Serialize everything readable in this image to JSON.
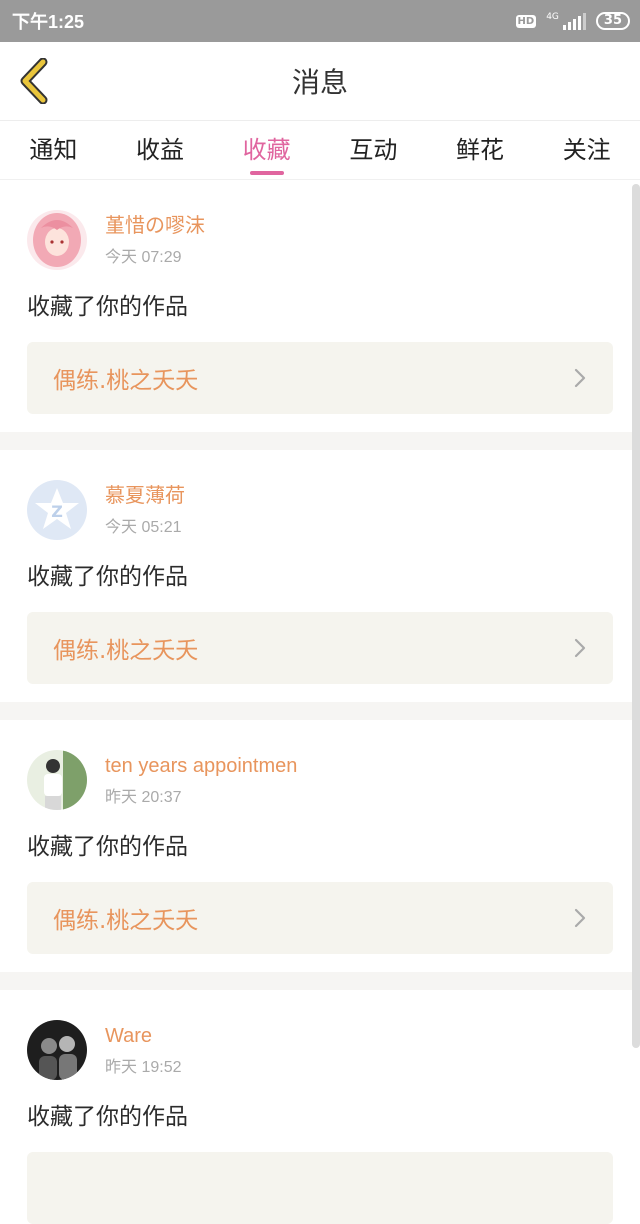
{
  "status_bar": {
    "time": "下午1:25",
    "hd": "HD",
    "network": "4G",
    "battery": "35"
  },
  "header": {
    "title": "消息"
  },
  "tabs": [
    {
      "label": "通知"
    },
    {
      "label": "收益"
    },
    {
      "label": "收藏",
      "active": true
    },
    {
      "label": "互动"
    },
    {
      "label": "鲜花"
    },
    {
      "label": "关注"
    }
  ],
  "messages": [
    {
      "user": "堇惜の嘐沫",
      "time": "今天 07:29",
      "action": "收藏了你的作品",
      "work": "偶练.桃之夭夭"
    },
    {
      "user": "慕夏薄荷",
      "time": "今天 05:21",
      "action": "收藏了你的作品",
      "work": "偶练.桃之夭夭"
    },
    {
      "user": "ten years appointmen",
      "time": "昨天 20:37",
      "action": "收藏了你的作品",
      "work": "偶练.桃之夭夭"
    },
    {
      "user": "Ware",
      "time": "昨天 19:52",
      "action": "收藏了你的作品",
      "work": ""
    }
  ],
  "colors": {
    "accent": "#e0659f",
    "name_orange": "#e8955d",
    "work_box_bg": "#f5f4ee",
    "back_icon": "#e9c53b"
  }
}
